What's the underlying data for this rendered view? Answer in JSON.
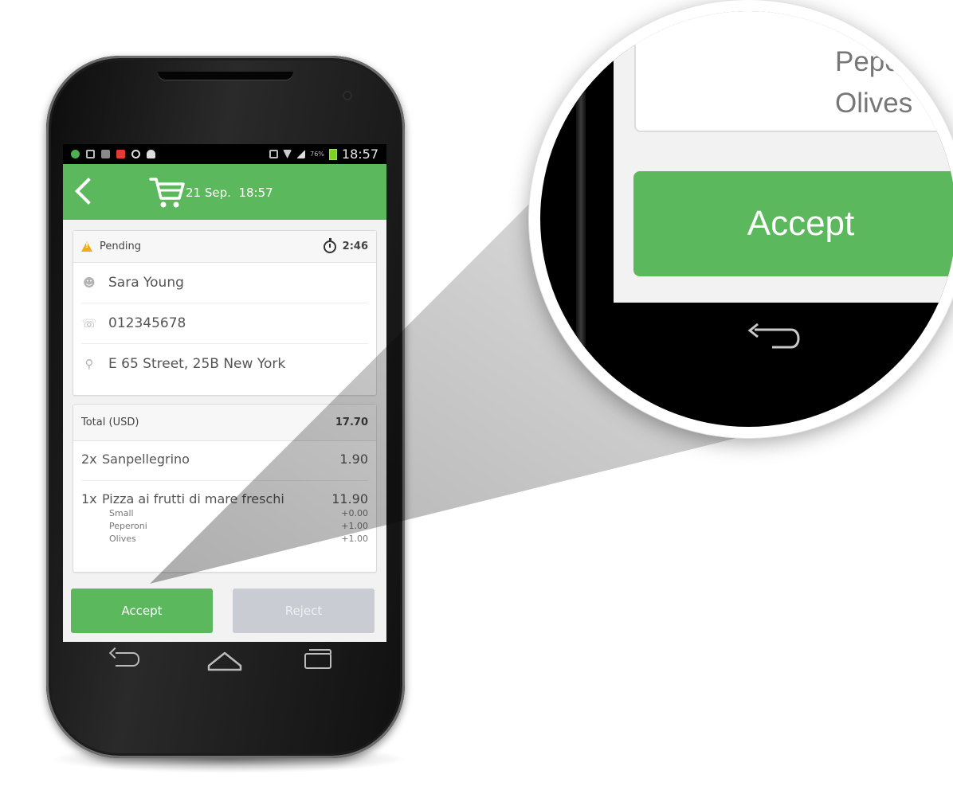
{
  "statusbar": {
    "time": "18:57",
    "battery_level": "76%"
  },
  "appbar": {
    "date": "21 Sep.",
    "time": "18:57",
    "cart_icon": "cart-icon",
    "back_icon": "chevron-left-icon"
  },
  "order": {
    "status": "Pending",
    "timer": "2:46",
    "customer_name": "Sara Young",
    "phone": "012345678",
    "address": "E 65 Street, 25B New York"
  },
  "summary": {
    "total_label": "Total (USD)",
    "total_value": "17.70",
    "items": [
      {
        "qty": "2x",
        "name": "Sanpellegrino",
        "price": "1.90"
      },
      {
        "qty": "1x",
        "name": "Pizza ai frutti di mare freschi",
        "price": "11.90"
      }
    ],
    "modifiers": [
      {
        "name": "Small",
        "price": "+0.00"
      },
      {
        "name": "Peperoni",
        "price": "+1.00"
      },
      {
        "name": "Olives",
        "price": "+1.00"
      }
    ]
  },
  "actions": {
    "accept_label": "Accept",
    "reject_label": "Reject"
  },
  "magnifier": {
    "modifier_1": "Peperoni",
    "modifier_2": "Olives",
    "accept_label": "Accept"
  },
  "colors": {
    "primary_green": "#5cb85c",
    "reject_gray": "#c9ccd3",
    "warning": "#f0ad1a"
  }
}
